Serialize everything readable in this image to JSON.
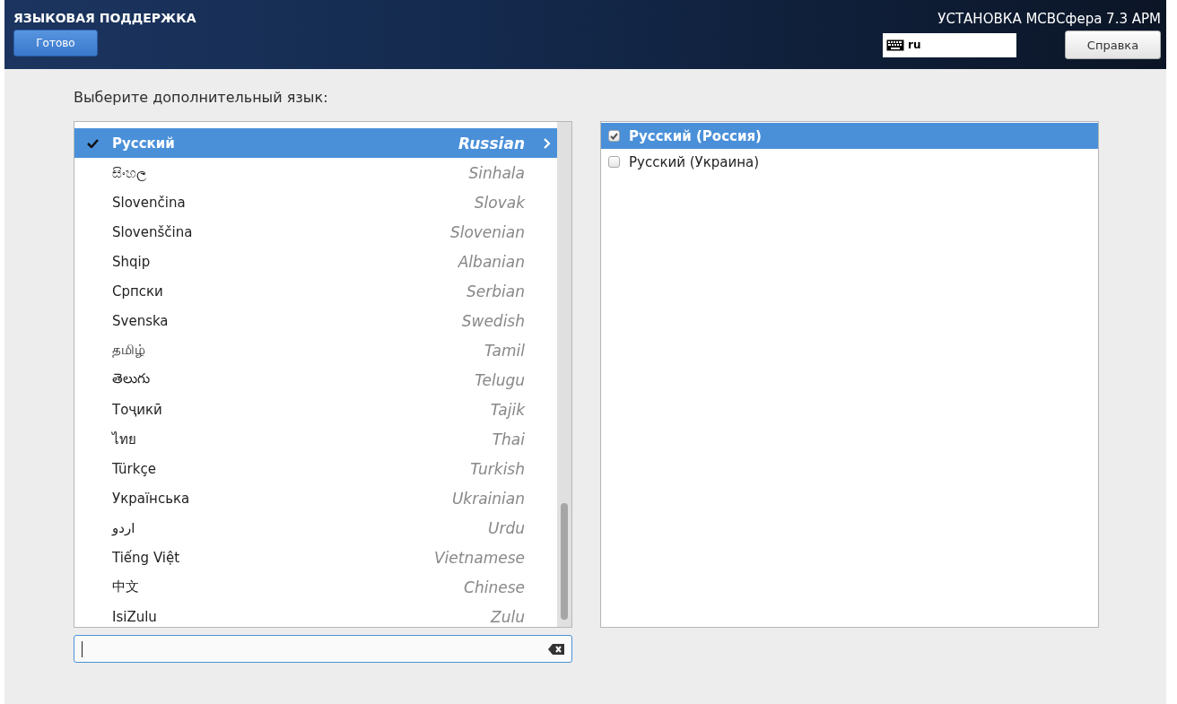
{
  "header": {
    "title": "ЯЗЫКОВАЯ ПОДДЕРЖКА",
    "done_button": "Готово",
    "product": "УСТАНОВКА МСВСфера 7.3 АРМ",
    "keyboard_layout": "ru",
    "help_button": "Справка"
  },
  "prompt": "Выберите дополнительный язык:",
  "languages": [
    {
      "native": "Русский",
      "english": "Russian",
      "checked": true,
      "selected": true
    },
    {
      "native": "සිංහල",
      "english": "Sinhala",
      "checked": false,
      "selected": false
    },
    {
      "native": "Slovenčina",
      "english": "Slovak",
      "checked": false,
      "selected": false
    },
    {
      "native": "Slovenščina",
      "english": "Slovenian",
      "checked": false,
      "selected": false
    },
    {
      "native": "Shqip",
      "english": "Albanian",
      "checked": false,
      "selected": false
    },
    {
      "native": "Српски",
      "english": "Serbian",
      "checked": false,
      "selected": false
    },
    {
      "native": "Svenska",
      "english": "Swedish",
      "checked": false,
      "selected": false
    },
    {
      "native": "தமிழ்",
      "english": "Tamil",
      "checked": false,
      "selected": false
    },
    {
      "native": "తెలుగు",
      "english": "Telugu",
      "checked": false,
      "selected": false
    },
    {
      "native": "Тоҷикӣ",
      "english": "Tajik",
      "checked": false,
      "selected": false
    },
    {
      "native": "ไทย",
      "english": "Thai",
      "checked": false,
      "selected": false
    },
    {
      "native": "Türkçe",
      "english": "Turkish",
      "checked": false,
      "selected": false
    },
    {
      "native": "Українська",
      "english": "Ukrainian",
      "checked": false,
      "selected": false
    },
    {
      "native": "اردو",
      "english": "Urdu",
      "checked": false,
      "selected": false
    },
    {
      "native": "Tiếng Việt",
      "english": "Vietnamese",
      "checked": false,
      "selected": false
    },
    {
      "native": "中文",
      "english": "Chinese",
      "checked": false,
      "selected": false
    },
    {
      "native": "IsiZulu",
      "english": "Zulu",
      "checked": false,
      "selected": false
    }
  ],
  "locales": [
    {
      "label": "Русский (Россия)",
      "checked": true,
      "selected": true
    },
    {
      "label": "Русский (Украина)",
      "checked": false,
      "selected": false
    }
  ]
}
